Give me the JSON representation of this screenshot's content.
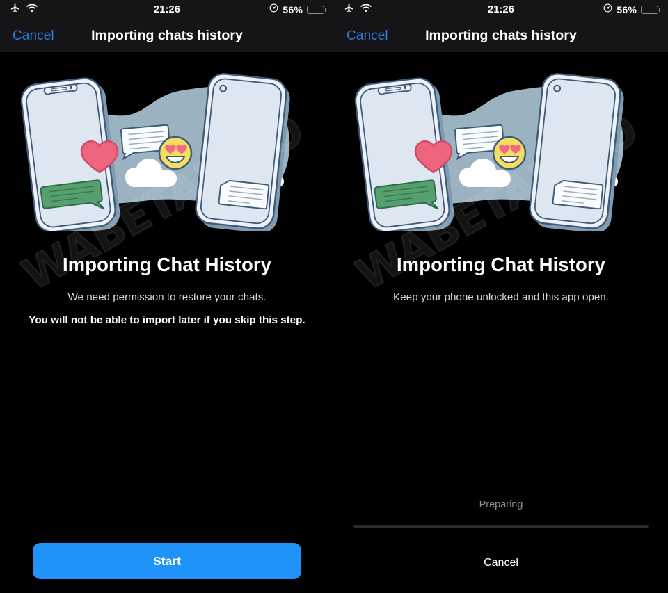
{
  "colors": {
    "accent_blue": "#1f93f7",
    "link_blue": "#2a7de1",
    "battery_yellow": "#f5cf10",
    "background": "#000000",
    "bar_background": "#151517",
    "illustration_blob": "#9bb2c1",
    "phone_body": "#e6ecf4",
    "phone_outline": "#3d5a78",
    "heart_pink": "#ef647f",
    "emoji_yellow": "#f5dd5d",
    "bubble_green": "#55a06e",
    "progress_track": "#2a2a2c",
    "muted_text": "#8e8e93"
  },
  "watermark": {
    "text": "WABETAINFO"
  },
  "panels": [
    {
      "id": "permission-screen",
      "status_bar": {
        "airplane_icon": "airplane-mode-icon",
        "wifi_icon": "wifi-icon",
        "time": "21:26",
        "location_icon": "location-services-icon",
        "battery_percent": "56%",
        "battery_level": 56,
        "battery_low_power": true
      },
      "nav_bar": {
        "cancel_label": "Cancel",
        "title": "Importing chats history"
      },
      "illustration": {
        "name": "two-phones-chat-transfer-illustration",
        "elements": [
          "phone-notch",
          "phone-punch-hole",
          "heart",
          "cloud",
          "heart-eyes-emoji",
          "chat-bubble-green",
          "chat-bubble-white"
        ]
      },
      "content": {
        "headline": "Importing Chat History",
        "subline": "We need permission to restore your chats.",
        "warning": "You will not be able to import later if you skip this step."
      },
      "footer": {
        "type": "button",
        "primary_button_label": "Start"
      }
    },
    {
      "id": "progress-screen",
      "status_bar": {
        "airplane_icon": "airplane-mode-icon",
        "wifi_icon": "wifi-icon",
        "time": "21:26",
        "location_icon": "location-services-icon",
        "battery_percent": "56%",
        "battery_level": 56,
        "battery_low_power": true
      },
      "nav_bar": {
        "cancel_label": "Cancel",
        "title": "Importing chats history"
      },
      "illustration": {
        "name": "two-phones-chat-transfer-illustration",
        "elements": [
          "phone-notch",
          "phone-punch-hole",
          "heart",
          "cloud",
          "heart-eyes-emoji",
          "chat-bubble-green",
          "chat-bubble-white"
        ]
      },
      "content": {
        "headline": "Importing Chat History",
        "subline": "Keep your phone unlocked and this app open.",
        "warning": ""
      },
      "footer": {
        "type": "progress",
        "status_label": "Preparing",
        "progress_percent": 0,
        "cancel_label": "Cancel"
      }
    }
  ]
}
